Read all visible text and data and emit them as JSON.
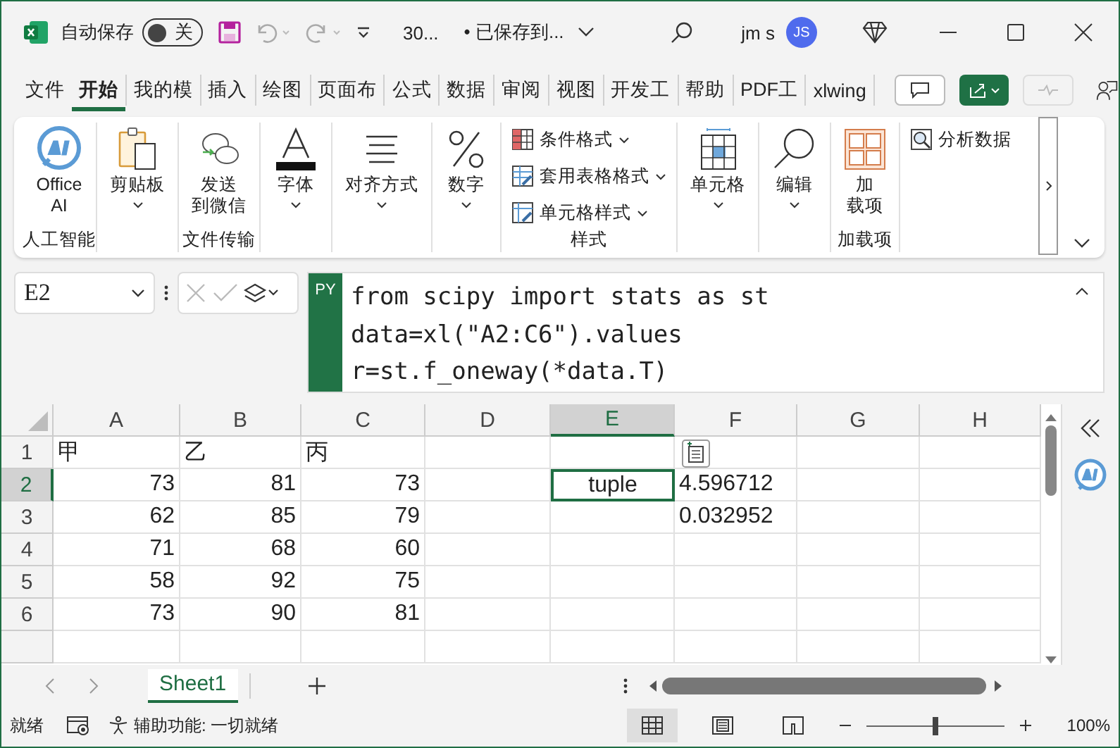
{
  "title_bar": {
    "autosave_label": "自动保存",
    "autosave": {
      "on": false,
      "label": "关"
    },
    "filename": "30...",
    "save_status": "• 已保存到...",
    "user": "jm s",
    "avatar": "JS"
  },
  "ribbon_tabs": [
    {
      "label": "文件",
      "selected": false
    },
    {
      "label": "开始",
      "selected": true
    },
    {
      "label": "我的模",
      "selected": false
    },
    {
      "label": "插入",
      "selected": false
    },
    {
      "label": "绘图",
      "selected": false
    },
    {
      "label": "页面布",
      "selected": false
    },
    {
      "label": "公式",
      "selected": false
    },
    {
      "label": "数据",
      "selected": false
    },
    {
      "label": "审阅",
      "selected": false
    },
    {
      "label": "视图",
      "selected": false
    },
    {
      "label": "开发工",
      "selected": false
    },
    {
      "label": "帮助",
      "selected": false
    },
    {
      "label": "PDF工",
      "selected": false
    },
    {
      "label": "xlwing",
      "selected": false
    }
  ],
  "ribbon_groups": [
    {
      "label": "人工智能",
      "items": [
        {
          "kind": "large",
          "lines": [
            "Office",
            "AI"
          ],
          "dropdown": false
        }
      ]
    },
    {
      "items": [
        {
          "kind": "large",
          "lines": [
            "剪贴板"
          ],
          "dropdown": true
        }
      ]
    },
    {
      "label": "文件传输",
      "items": [
        {
          "kind": "large",
          "lines": [
            "发送",
            "到微信"
          ],
          "dropdown": false
        }
      ]
    },
    {
      "items": [
        {
          "kind": "large",
          "lines": [
            "字体"
          ],
          "dropdown": true
        }
      ]
    },
    {
      "items": [
        {
          "kind": "large",
          "lines": [
            "对齐方式"
          ],
          "dropdown": true
        }
      ]
    },
    {
      "items": [
        {
          "kind": "large",
          "lines": [
            "数字"
          ],
          "dropdown": true
        }
      ]
    },
    {
      "label": "样式",
      "items": [
        {
          "kind": "small",
          "lines": [
            "条件格式"
          ],
          "dropdown": true
        },
        {
          "kind": "small",
          "lines": [
            "套用表格格式"
          ],
          "dropdown": true
        },
        {
          "kind": "small",
          "lines": [
            "单元格样式"
          ],
          "dropdown": true
        }
      ]
    },
    {
      "items": [
        {
          "kind": "large",
          "lines": [
            "单元格"
          ],
          "dropdown": true
        }
      ]
    },
    {
      "items": [
        {
          "kind": "large",
          "lines": [
            "编辑"
          ],
          "dropdown": true
        }
      ]
    },
    {
      "label": "加载项",
      "items": [
        {
          "kind": "large",
          "lines": [
            "加",
            "载项"
          ],
          "dropdown": false
        }
      ]
    },
    {
      "items": [
        {
          "kind": "small",
          "lines": [
            "分析数据"
          ],
          "dropdown": false
        }
      ]
    }
  ],
  "formula_bar": {
    "name_box": "E2",
    "badge": "PY",
    "lines": [
      "from scipy import stats as st",
      "data=xl(\"A2:C6\").values",
      "r=st.f_oneway(*data.T)"
    ]
  },
  "columns": [
    {
      "label": "A",
      "selected": false
    },
    {
      "label": "B",
      "selected": false
    },
    {
      "label": "C",
      "selected": false
    },
    {
      "label": "D",
      "selected": false
    },
    {
      "label": "E",
      "selected": true
    },
    {
      "label": "F",
      "selected": false
    },
    {
      "label": "G",
      "selected": false
    },
    {
      "label": "H",
      "selected": false
    }
  ],
  "rows": [
    {
      "header": "1",
      "selected": false,
      "cells": {
        "A": {
          "value": "甲",
          "kind": "text",
          "selected": false
        },
        "B": {
          "value": "乙",
          "kind": "text",
          "selected": false
        },
        "C": {
          "value": "丙",
          "kind": "text",
          "selected": false
        }
      }
    },
    {
      "header": "2",
      "selected": true,
      "cells": {
        "A": {
          "value": "73",
          "kind": "number",
          "selected": false
        },
        "B": {
          "value": "81",
          "kind": "number",
          "selected": false
        },
        "C": {
          "value": "73",
          "kind": "number",
          "selected": false
        },
        "E": {
          "value": "tuple",
          "kind": "object",
          "selected": true
        },
        "F": {
          "value": "4.596712",
          "kind": "text",
          "selected": false
        }
      }
    },
    {
      "header": "3",
      "selected": false,
      "cells": {
        "A": {
          "value": "62",
          "kind": "number",
          "selected": false
        },
        "B": {
          "value": "85",
          "kind": "number",
          "selected": false
        },
        "C": {
          "value": "79",
          "kind": "number",
          "selected": false
        },
        "F": {
          "value": "0.032952",
          "kind": "text",
          "selected": false
        }
      }
    },
    {
      "header": "4",
      "selected": false,
      "cells": {
        "A": {
          "value": "71",
          "kind": "number",
          "selected": false
        },
        "B": {
          "value": "68",
          "kind": "number",
          "selected": false
        },
        "C": {
          "value": "60",
          "kind": "number",
          "selected": false
        }
      }
    },
    {
      "header": "5",
      "selected": false,
      "cells": {
        "A": {
          "value": "58",
          "kind": "number",
          "selected": false
        },
        "B": {
          "value": "92",
          "kind": "number",
          "selected": false
        },
        "C": {
          "value": "75",
          "kind": "number",
          "selected": false
        }
      }
    },
    {
      "header": "6",
      "selected": false,
      "cells": {
        "A": {
          "value": "73",
          "kind": "number",
          "selected": false
        },
        "B": {
          "value": "90",
          "kind": "number",
          "selected": false
        },
        "C": {
          "value": "81",
          "kind": "number",
          "selected": false
        }
      }
    }
  ],
  "sheets": [
    {
      "name": "Sheet1",
      "selected": true
    }
  ],
  "status_bar": {
    "ready": "就绪",
    "accessibility": "辅助功能: 一切就绪",
    "views": [
      {
        "kind": "normal",
        "selected": true
      },
      {
        "kind": "page-layout",
        "selected": false
      },
      {
        "kind": "page-break",
        "selected": false
      }
    ],
    "zoom": {
      "level": 0.5,
      "label": "100%"
    }
  }
}
